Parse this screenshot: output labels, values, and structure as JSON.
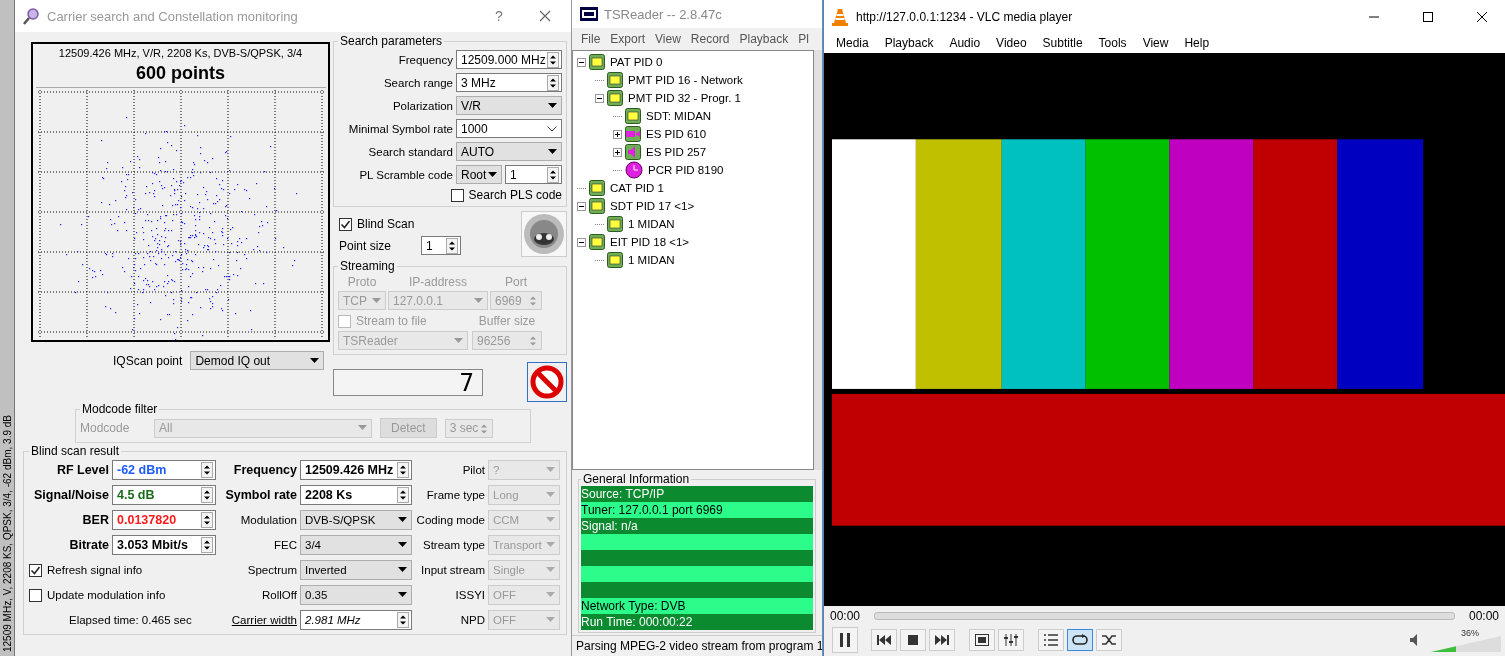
{
  "background_app": {
    "vertical_text": "12509 MHz, V, 2208 KS, QPSK, 3/4, -62 dBm, 3.9 dB"
  },
  "carrier_window": {
    "title": "Carrier search and Constellation monitoring",
    "help": "?",
    "constellation": {
      "info": "12509.426 MHz, V/R, 2208 Ks, DVB-S/QPSK, 3/4",
      "points_label": "600 points"
    },
    "iqscan": {
      "label": "IQScan point",
      "value": "Demod IQ out"
    },
    "search_parameters": {
      "title": "Search parameters",
      "fields": [
        {
          "label": "Frequency",
          "value": "12509.000 MHz",
          "kind": "spin"
        },
        {
          "label": "Search range",
          "value": "3 MHz",
          "kind": "spin"
        },
        {
          "label": "Polarization",
          "value": "V/R",
          "kind": "combo"
        },
        {
          "label": "Minimal Symbol rate",
          "value": "1000",
          "kind": "edit"
        },
        {
          "label": "Search standard",
          "value": "AUTO",
          "kind": "combo"
        },
        {
          "label": "PL Scramble code",
          "value": "Root",
          "value2": "1",
          "kind": "pls"
        }
      ],
      "search_pls": {
        "label": "Search PLS code",
        "checked": false
      }
    },
    "blind_scan": {
      "label": "Blind Scan",
      "checked": true
    },
    "point_size": {
      "label": "Point size",
      "value": "1"
    },
    "streaming": {
      "title": "Streaming",
      "disabled": true,
      "proto_label": "Proto",
      "ip_label": "IP-address",
      "port_label": "Port",
      "proto": "TCP",
      "ip": "127.0.0.1",
      "port": "6969",
      "stream_to_file": {
        "label": "Stream to file",
        "checked": false
      },
      "buffer_label": "Buffer size",
      "target": "TSReader",
      "buffer": "96256"
    },
    "counter": "7",
    "modcode_filter": {
      "title": "Modcode filter",
      "disabled": true,
      "label": "Modcode",
      "value": "All",
      "detect": "Detect",
      "time": "3 sec"
    },
    "result": {
      "title": "Blind scan result",
      "signal": [
        {
          "label": "RF Level",
          "value": "-62 dBm",
          "color": "#1f5cff"
        },
        {
          "label": "Signal/Noise",
          "value": "4.5 dB",
          "color": "#1a6b1a"
        },
        {
          "label": "BER",
          "value": "0.0137820",
          "color": "#ff1a1a"
        },
        {
          "label": "Bitrate",
          "value": "3.053 Mbit/s",
          "color": "#000000"
        }
      ],
      "options": [
        {
          "label": "Refresh signal info",
          "checked": true
        },
        {
          "label": "Update modulation info",
          "checked": false
        }
      ],
      "elapsed": "Elapsed time: 0.465 sec",
      "middle": [
        {
          "label": "Frequency",
          "value": "12509.426 MHz",
          "kind": "spin_bold"
        },
        {
          "label": "Symbol rate",
          "value": "2208 Ks",
          "kind": "spin_bold"
        },
        {
          "label": "Modulation",
          "value": "DVB-S/QPSK",
          "kind": "combo"
        },
        {
          "label": "FEC",
          "value": "3/4",
          "kind": "combo"
        },
        {
          "label": "Spectrum",
          "value": "Inverted",
          "kind": "combo"
        },
        {
          "label": "RollOff",
          "value": "0.35",
          "kind": "combo"
        },
        {
          "label": "Carrier width",
          "value": "2.981 MHz",
          "kind": "link_spin"
        }
      ],
      "right": [
        {
          "label": "Pilot",
          "value": "?",
          "disabled": true
        },
        {
          "label": "Frame type",
          "value": "Long",
          "disabled": true
        },
        {
          "label": "Coding mode",
          "value": "CCM",
          "disabled": true
        },
        {
          "label": "Stream type",
          "value": "Transport",
          "disabled": true
        },
        {
          "label": "Input stream",
          "value": "Single",
          "disabled": true
        },
        {
          "label": "ISSYI",
          "value": "OFF",
          "disabled": true
        },
        {
          "label": "NPD",
          "value": "OFF",
          "disabled": true
        }
      ]
    }
  },
  "tsreader": {
    "title": "TSReader -- 2.8.47c",
    "menu": [
      "File",
      "Export",
      "View",
      "Record",
      "Playback",
      "Pl"
    ],
    "tree": [
      {
        "label": "PAT PID 0",
        "kind": "table",
        "expanded": true,
        "children": [
          {
            "label": "PMT PID 16 - Network",
            "kind": "table"
          },
          {
            "label": "PMT PID 32 - Progr. 1",
            "kind": "table",
            "expanded": true,
            "children": [
              {
                "label": "SDT: MIDAN",
                "kind": "table"
              },
              {
                "label": "ES PID 610",
                "kind": "video",
                "expanded": false
              },
              {
                "label": "ES PID 257",
                "kind": "audio",
                "expanded": false
              },
              {
                "label": "PCR PID 8190",
                "kind": "clock"
              }
            ]
          }
        ]
      },
      {
        "label": "CAT PID 1",
        "kind": "table"
      },
      {
        "label": "SDT PID 17 <1>",
        "kind": "table",
        "expanded": true,
        "children": [
          {
            "label": "1 MIDAN",
            "kind": "table"
          }
        ]
      },
      {
        "label": "EIT PID 18 <1>",
        "kind": "table",
        "expanded": true,
        "children": [
          {
            "label": "1 MIDAN",
            "kind": "table"
          }
        ]
      }
    ],
    "general_info": {
      "title": "General Information",
      "top_lines": [
        "Source: TCP/IP",
        "Tuner: 127.0.0.1 port 6969",
        "Signal: n/a"
      ],
      "bottom_lines": [
        "Network Type: DVB",
        "Run Time: 000:00:22"
      ]
    },
    "status": "Parsing MPEG-2 video stream from program 1"
  },
  "vlc": {
    "title": "http://127.0.0.1:1234 - VLC media player",
    "menu": [
      "Media",
      "Playback",
      "Audio",
      "Video",
      "Subtitle",
      "Tools",
      "View",
      "Help"
    ],
    "elapsed": "00:00",
    "total": "00:00",
    "loop_on": true,
    "volume": {
      "reading": "36%",
      "level": 0.36
    }
  }
}
